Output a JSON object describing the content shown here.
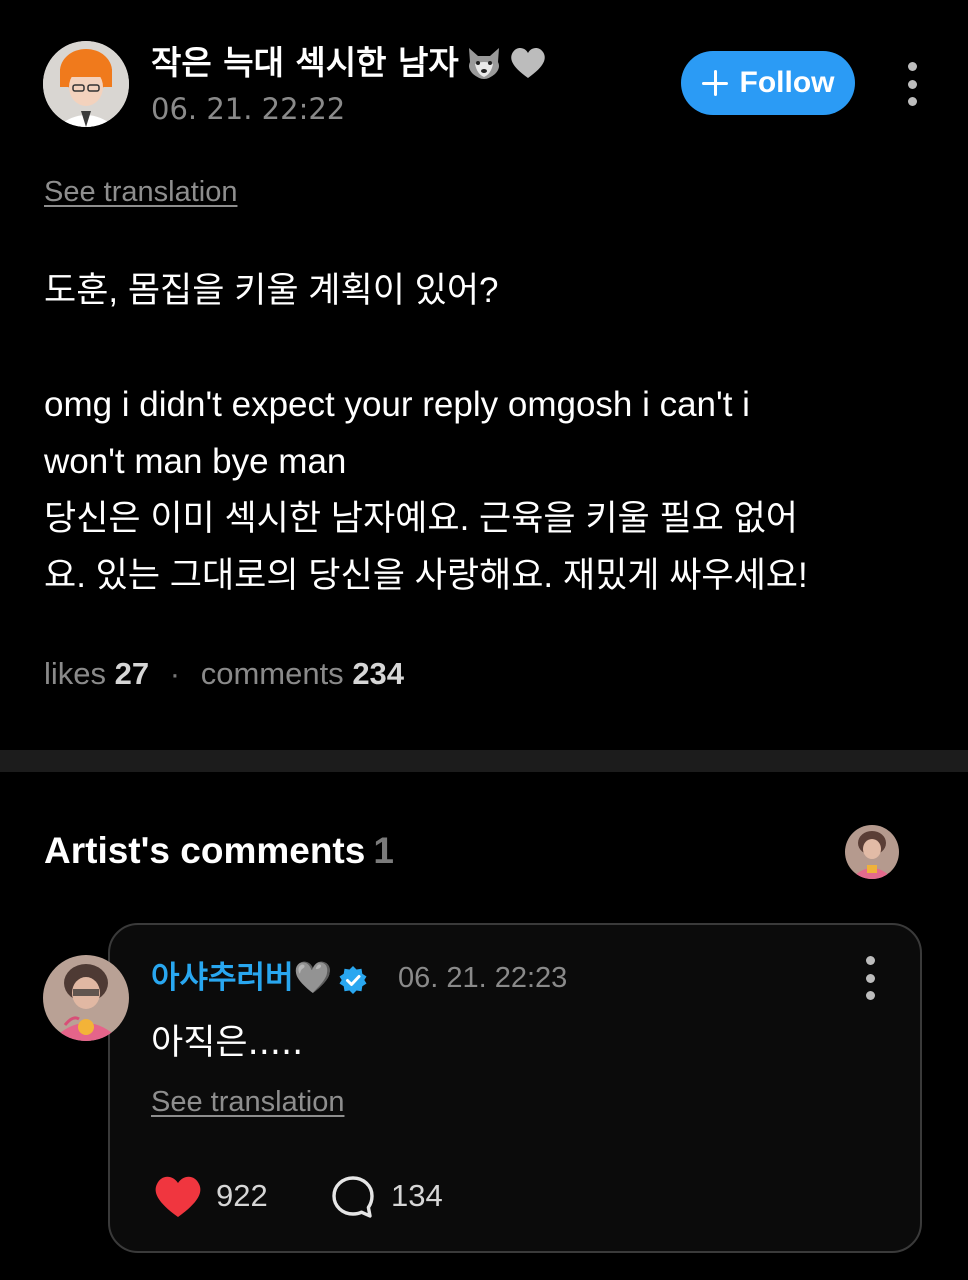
{
  "post": {
    "author_name": "작은 늑대 섹시한 남자",
    "author_emojis": [
      "wolf-emoji",
      "white-heart-emoji"
    ],
    "timestamp": "06. 21. 22:22",
    "follow_label": "Follow",
    "see_translation": "See translation",
    "body_korean_question": "도훈, 몸집을 키울 계획이 있어?",
    "body_english_line1": "omg i didn't expect your reply omgosh i can't i",
    "body_english_line2": "won't man bye man",
    "body_korean_reply_line1": "당신은 이미 섹시한 남자예요. 근육을 키울 필요 없어",
    "body_korean_reply_line2": "요. 있는 그대로의 당신을 사랑해요. 재밌게 싸우세요!",
    "likes_label": "likes",
    "likes_count": "27",
    "comments_label": "comments",
    "comments_count": "234"
  },
  "artist_comments": {
    "heading": "Artist's comments",
    "count": "1",
    "comment": {
      "author_name": "아샤추러버🩶",
      "verified": true,
      "timestamp": "06. 21. 22:23",
      "text": "아직은.....",
      "see_translation": "See translation",
      "like_count": "922",
      "reply_count": "134"
    }
  },
  "colors": {
    "background": "#000000",
    "follow_button": "#2b9bf5",
    "artist_name": "#29a7f0",
    "like_heart": "#f0363f",
    "muted_text": "#8a8a8a",
    "divider": "#1c1c1c"
  },
  "icons": [
    "more-vertical-icon",
    "plus-icon",
    "verified-badge-icon",
    "heart-icon",
    "comment-bubble-icon"
  ]
}
